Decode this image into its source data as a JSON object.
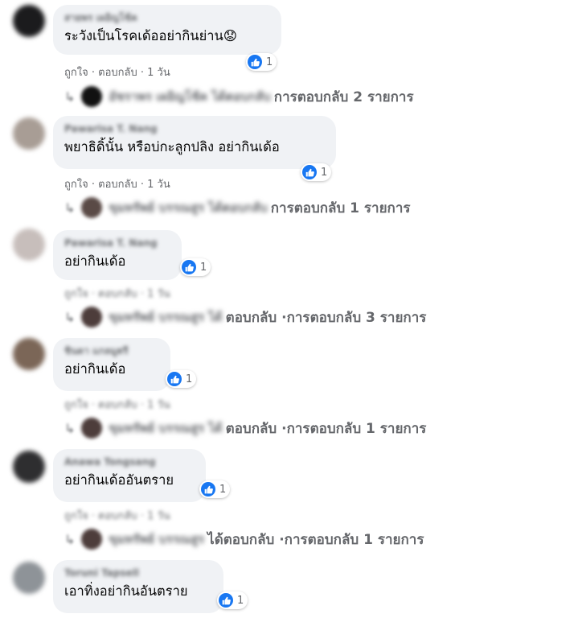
{
  "ui": {
    "like_label": "ถูกใจ",
    "reply_label": "ตอบกลับ",
    "separator": " · "
  },
  "comments": [
    {
      "author": "สายพร เผอิญโช้ค",
      "text": "ระวังเป็นโรคเด้ออย่ากินย่าน",
      "emoji": "😟",
      "reactions": "1",
      "time": "1 วัน",
      "reply_author": "อัชราพร เผอิญโช้ค ได้ตอบกลับ",
      "reply_tail": "",
      "reply_count": "การตอบกลับ 2 รายการ"
    },
    {
      "author": "Pawarisa T. Nang",
      "text": "พยาธิดิ้นั้น หรือบ่กะลูกปลิง อย่ากินเด้อ",
      "emoji": "",
      "reactions": "1",
      "time": "1 วัน",
      "reply_author": "ขุมทรัพย์ บรรณสูร ได้ตอบกลับ",
      "reply_tail": "",
      "reply_count": "การตอบกลับ 1 รายการ"
    },
    {
      "author": "Pawarisa T. Nang",
      "text": "อย่ากินเด้อ",
      "emoji": "",
      "reactions": "1",
      "time": "1 วัน",
      "reply_author": "ขุมทรัพย์ บรรณสูร ได้",
      "reply_tail": "ตอบกลับ · ",
      "reply_count": "การตอบกลับ 3 รายการ"
    },
    {
      "author": "ชินดา แกลมูตรี",
      "text": "อย่ากินเด้อ",
      "emoji": "",
      "reactions": "1",
      "time": "1 วัน",
      "reply_author": "ขุมทรัพย์ บรรณสูร ได้",
      "reply_tail": "ตอบกลับ · ",
      "reply_count": "การตอบกลับ 1 รายการ"
    },
    {
      "author": "Anawa Tongsang",
      "text": "อย่ากินเด้ออันตราย",
      "emoji": "",
      "reactions": "1",
      "time": "1 วัน",
      "reply_author": "ขุมทรัพย์ บรรณสูร ",
      "reply_tail": "ได้ตอบกลับ · ",
      "reply_count": "การตอบกลับ 1 รายการ"
    },
    {
      "author": "Toruni Tapsell",
      "text": "เอาทิ่งอย่ากินอันตราย",
      "emoji": "",
      "reactions": "1"
    }
  ],
  "colors": {
    "like_blue": "#1877f2",
    "bubble_bg": "#f0f2f5",
    "meta_gray": "#65676b"
  }
}
